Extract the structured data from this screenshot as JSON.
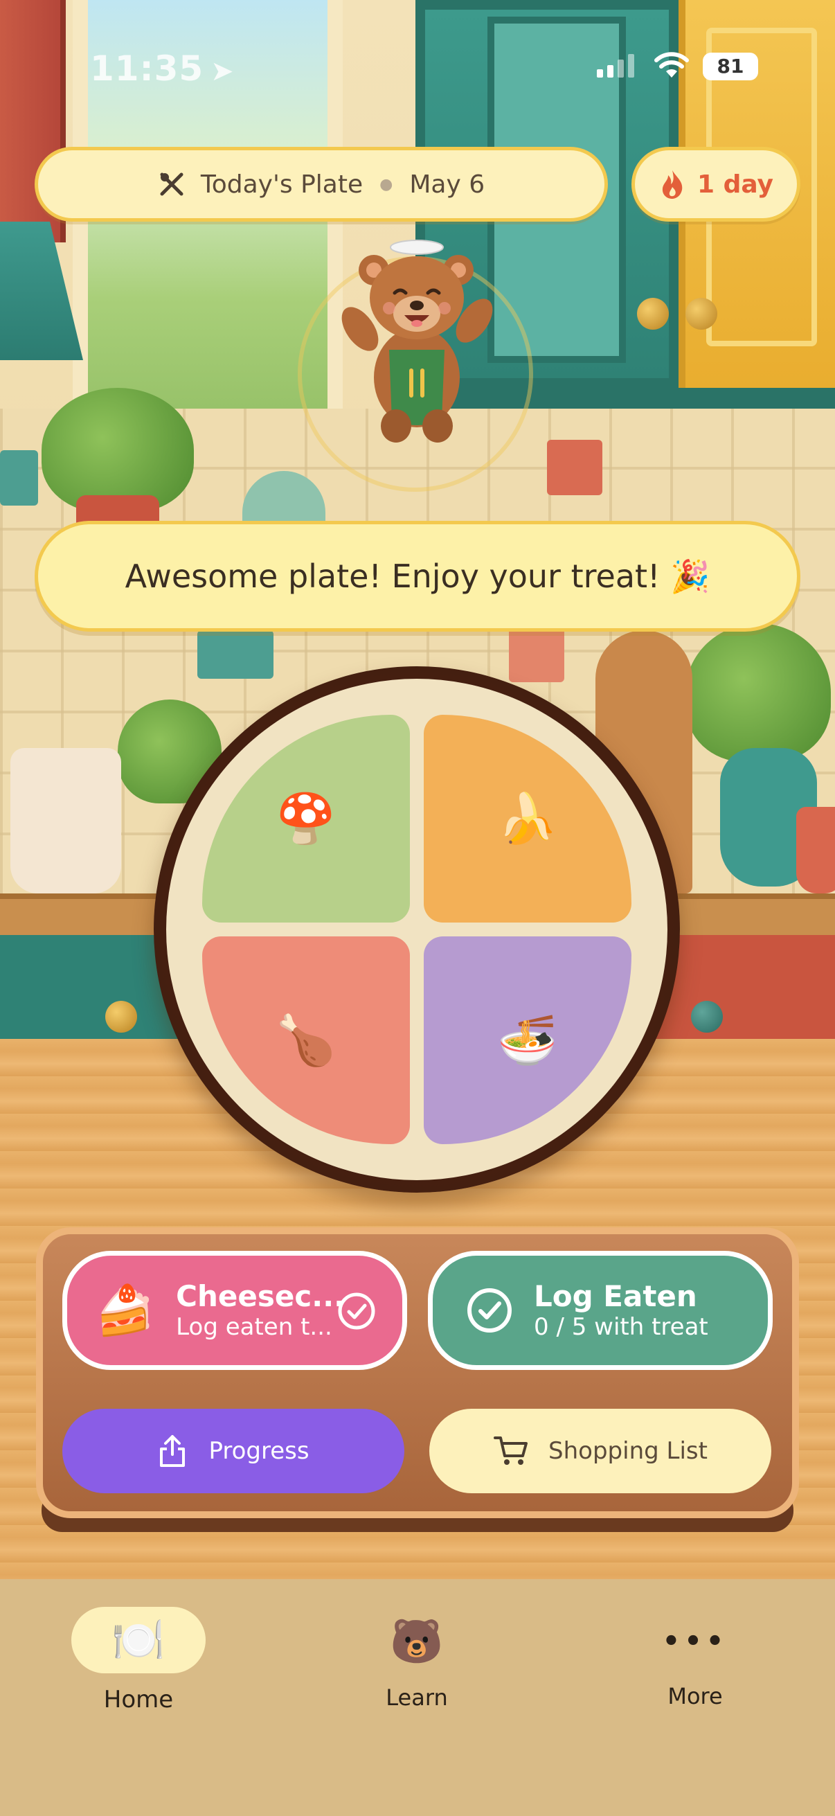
{
  "status_bar": {
    "time": "11:35",
    "battery": "81"
  },
  "header": {
    "plate_label": "Today's Plate",
    "date": "May 6",
    "streak": "1 day"
  },
  "mascot": {
    "message": "Awesome plate! Enjoy your treat! 🎉"
  },
  "plate": {
    "sections": [
      {
        "emoji": "🍄",
        "color": "#b7d08a"
      },
      {
        "emoji": "🍌",
        "color": "#f3b057"
      },
      {
        "emoji": "🍗",
        "color": "#ee8c78"
      },
      {
        "emoji": "🍜",
        "color": "#b69bd0"
      }
    ]
  },
  "actions": {
    "treat": {
      "emoji": "🍰",
      "title": "Cheesec...",
      "subtitle": "Log eaten t..."
    },
    "log_eaten": {
      "title": "Log Eaten",
      "subtitle": "0 / 5 with treat"
    },
    "progress_label": "Progress",
    "shopping_label": "Shopping List"
  },
  "tabs": [
    {
      "label": "Home",
      "icon": "🍽️"
    },
    {
      "label": "Learn",
      "icon": "🐻"
    },
    {
      "label": "More",
      "icon": "•••"
    }
  ],
  "colors": {
    "accent_pink": "#ea6a8f",
    "accent_green": "#5aa58a",
    "accent_purple": "#8a5de6",
    "streak_orange": "#e35f3a",
    "pill_bg": "#fdf1bb"
  }
}
